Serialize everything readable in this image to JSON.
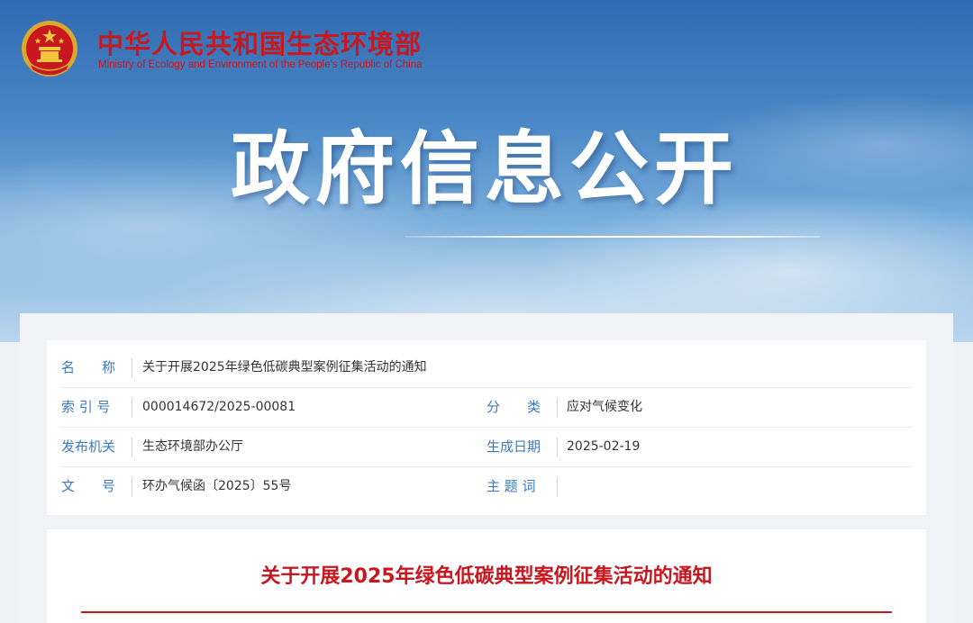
{
  "header": {
    "ministry_cn": "中华人民共和国生态环境部",
    "ministry_en": "Ministry of Ecology and Environment of the People's Republic of China",
    "hero_title": "政府信息公开"
  },
  "info": {
    "name_label": "名　　称",
    "name_value": "关于开展2025年绿色低碳典型案例征集活动的通知",
    "index_label": "索 引 号",
    "index_value": "000014672/2025-00081",
    "category_label": "分　　类",
    "category_value": "应对气候变化",
    "issuer_label": "发布机关",
    "issuer_value": "生态环境部办公厅",
    "date_label": "生成日期",
    "date_value": "2025-02-19",
    "docno_label": "文　　号",
    "docno_value": "环办气候函〔2025〕55号",
    "subject_label": "主 题 词",
    "subject_value": ""
  },
  "document": {
    "title": "关于开展2025年绿色低碳典型案例征集活动的通知"
  },
  "colors": {
    "brand_red": "#c8171e",
    "label_blue": "#3a7bc0"
  },
  "icons": {
    "emblem": "national-emblem-icon"
  }
}
